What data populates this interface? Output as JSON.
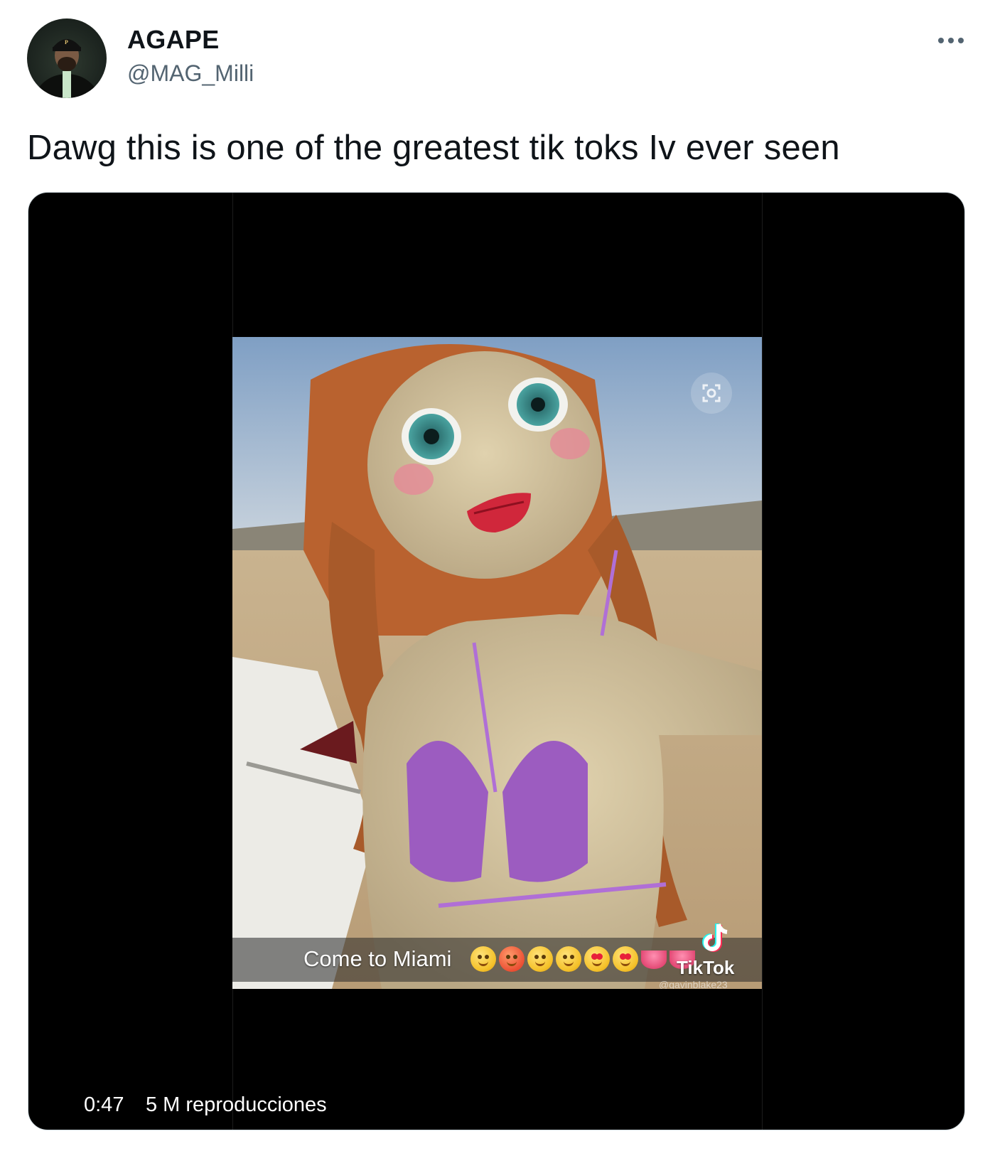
{
  "author": {
    "display_name": "AGAPE",
    "handle": "@MAG_Milli"
  },
  "tweet": {
    "text": "Dawg this is one of the greatest tik toks Iv ever seen"
  },
  "video": {
    "duration": "0:47",
    "views": "5 M reproducciones",
    "caption": "Come to Miami",
    "caption_emojis": [
      "weary-face-icon",
      "hot-face-icon",
      "relieved-face-icon",
      "smiling-face-with-hearts-icon",
      "heart-eyes-icon",
      "heart-eyes-icon",
      "lips-icon",
      "lips-icon"
    ],
    "watermark": "TikTok",
    "watermark_user": "@gavinblake23"
  },
  "colors": {
    "secondary_text": "#536471",
    "media_background": "#000000"
  }
}
